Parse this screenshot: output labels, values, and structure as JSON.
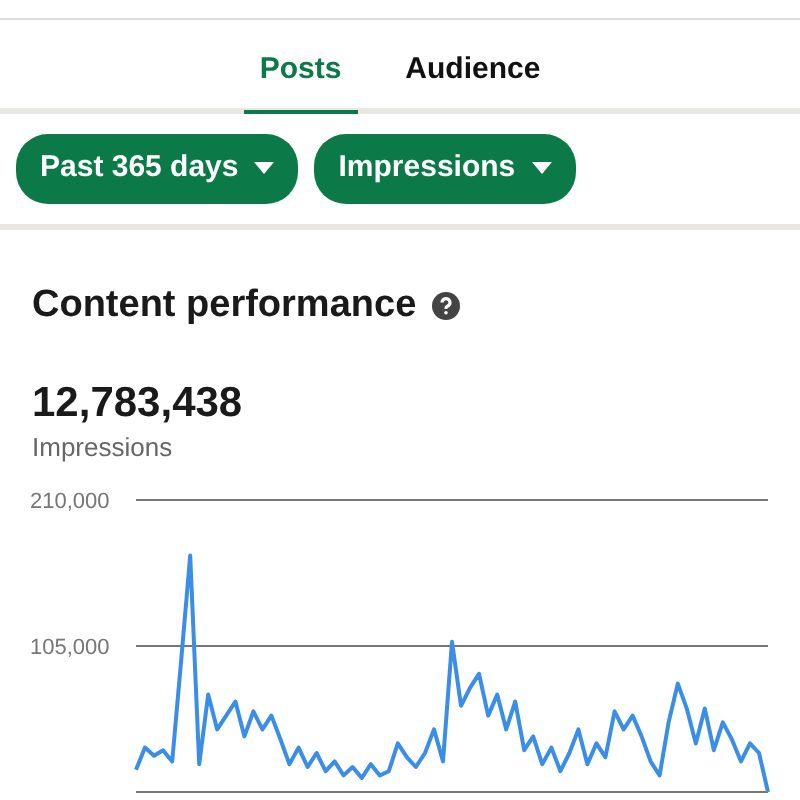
{
  "tabs": [
    {
      "label": "Posts",
      "selected": true
    },
    {
      "label": "Audience",
      "selected": false
    }
  ],
  "filters": [
    {
      "label": "Past 365 days"
    },
    {
      "label": "Impressions"
    }
  ],
  "card": {
    "title": "Content performance",
    "total": "12,783,438",
    "total_label": "Impressions",
    "chart_data": {
      "type": "line",
      "ylim": [
        0,
        210000
      ],
      "yticks": [
        {
          "value": 105000,
          "label": "105,000"
        },
        {
          "value": 210000,
          "label": "210,000"
        }
      ],
      "series": [
        {
          "color": "#3a8ee8",
          "values": [
            16000,
            32000,
            26000,
            30000,
            22000,
            95000,
            170000,
            20000,
            70000,
            45000,
            55000,
            65000,
            40000,
            58000,
            45000,
            55000,
            38000,
            20000,
            32000,
            18000,
            28000,
            15000,
            22000,
            12000,
            18000,
            10000,
            20000,
            12000,
            15000,
            35000,
            25000,
            18000,
            28000,
            45000,
            22000,
            108000,
            62000,
            75000,
            85000,
            55000,
            70000,
            45000,
            65000,
            30000,
            40000,
            20000,
            32000,
            15000,
            28000,
            45000,
            20000,
            35000,
            25000,
            58000,
            45000,
            55000,
            40000,
            22000,
            12000,
            50000,
            78000,
            60000,
            35000,
            60000,
            30000,
            50000,
            38000,
            22000,
            35000,
            28000,
            0
          ]
        }
      ]
    }
  }
}
